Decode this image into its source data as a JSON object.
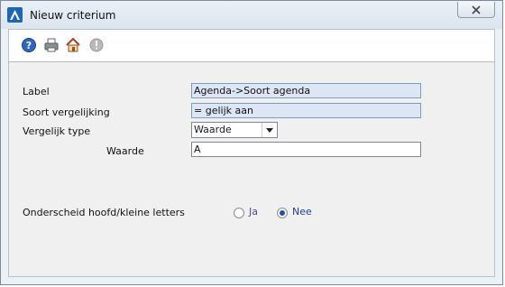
{
  "window": {
    "title": "Nieuw criterium"
  },
  "toolbar": {
    "icons": [
      "help-icon",
      "print-icon",
      "home-icon",
      "info-icon"
    ]
  },
  "form": {
    "label": {
      "caption": "Label",
      "value": "Agenda->Soort agenda"
    },
    "comparison": {
      "caption": "Soort vergelijking",
      "value": "=  gelijk aan"
    },
    "compare_type": {
      "caption": "Vergelijk type",
      "value": "Waarde"
    },
    "value": {
      "caption": "Waarde",
      "value": "A"
    },
    "case_sensitive": {
      "caption": "Onderscheid hoofd/kleine letters",
      "options": [
        {
          "label": "Ja",
          "selected": false
        },
        {
          "label": "Nee",
          "selected": true
        }
      ]
    }
  },
  "colors": {
    "readonly_field": "#dce6f4",
    "radio_selected": "#1f4fa8",
    "app_icon": "#1d66b5"
  }
}
